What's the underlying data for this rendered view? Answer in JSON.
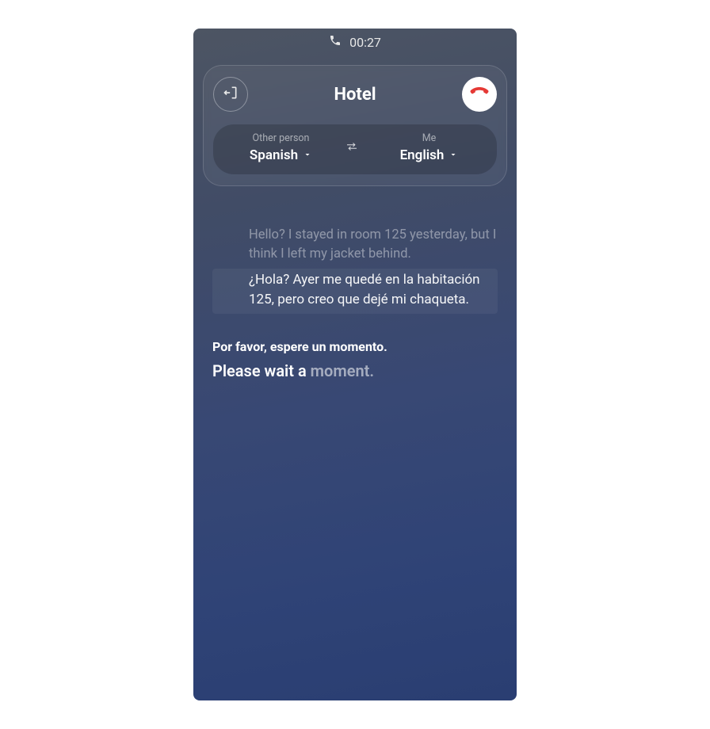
{
  "status": {
    "call_duration": "00:27"
  },
  "header": {
    "contact_name": "Hotel"
  },
  "languages": {
    "other_label": "Other person",
    "other_value": "Spanish",
    "me_label": "Me",
    "me_value": "English"
  },
  "messages": {
    "me": {
      "original": "Hello? I stayed in room 125 yesterday, but I think I left my jacket behind.",
      "translated": "¿Hola? Ayer me quedé en la habitación 125, pero creo que dejé mi chaqueta."
    },
    "other": {
      "original": "Por favor, espere un momento.",
      "translated_typed": "Please wait a ",
      "translated_pending": "moment."
    }
  }
}
